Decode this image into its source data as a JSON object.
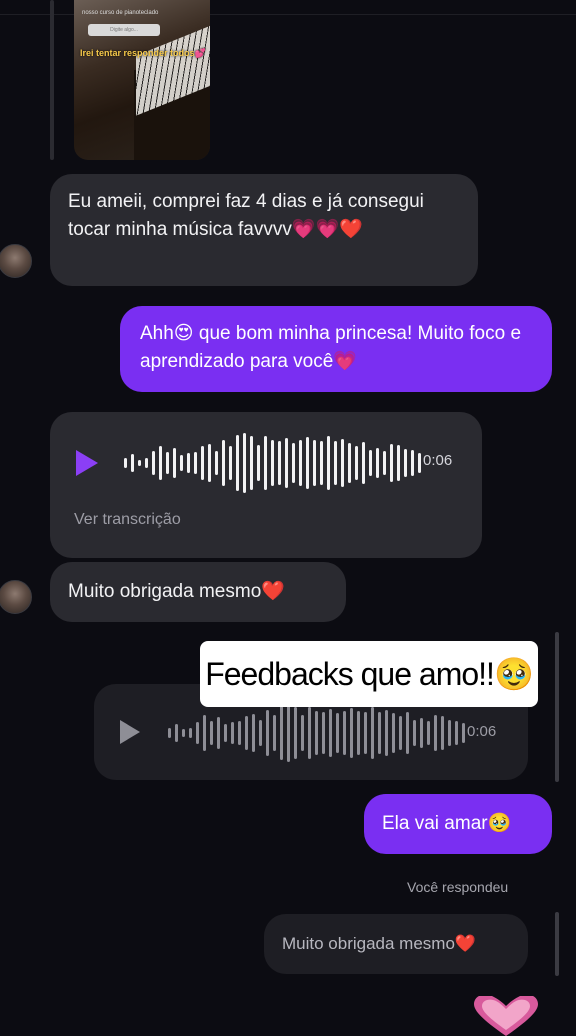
{
  "story": {
    "caption_top": "nosso curso de pianoteclado",
    "input_placeholder": "Digite algo...",
    "overlay_caption": "Irei tentar responder todos💕"
  },
  "messages": {
    "m1_text": "Eu ameii, comprei faz 4 dias e já consegui tocar minha música favvvv💗💗❤️",
    "m2_text": "Ahh😍 que bom minha princesa! Muito foco e aprendizado para você💗",
    "m4_text": "Muito obrigada mesmo❤️",
    "m6_text": "Ela vai amar🥹",
    "m7_text": "Muito obrigada mesmo❤️"
  },
  "audio1": {
    "duration": "0:06",
    "transcript_link": "Ver transcrição",
    "bars": [
      10,
      18,
      6,
      10,
      24,
      34,
      22,
      30,
      16,
      20,
      22,
      34,
      38,
      24,
      46,
      34,
      56,
      60,
      54,
      36,
      54,
      46,
      44,
      50,
      40,
      46,
      52,
      46,
      44,
      54,
      44,
      48,
      40,
      34,
      42,
      26,
      30,
      24,
      38,
      36,
      28,
      26,
      20
    ]
  },
  "audio2": {
    "duration": "0:06",
    "bars": [
      10,
      18,
      8,
      10,
      22,
      36,
      24,
      32,
      18,
      22,
      24,
      34,
      38,
      26,
      46,
      36,
      54,
      58,
      52,
      36,
      52,
      44,
      42,
      48,
      40,
      44,
      50,
      44,
      42,
      52,
      42,
      46,
      40,
      34,
      42,
      26,
      30,
      24,
      36,
      34,
      26,
      24,
      20
    ]
  },
  "sticker_text": "Feedbacks que amo!!🥹",
  "reply_label": "Você respondeu",
  "colors": {
    "background": "#0c0c12",
    "incoming_bubble": "#2a2a30",
    "outgoing_bubble": "#7a2ff2",
    "play_accent": "#8b3ff5"
  }
}
